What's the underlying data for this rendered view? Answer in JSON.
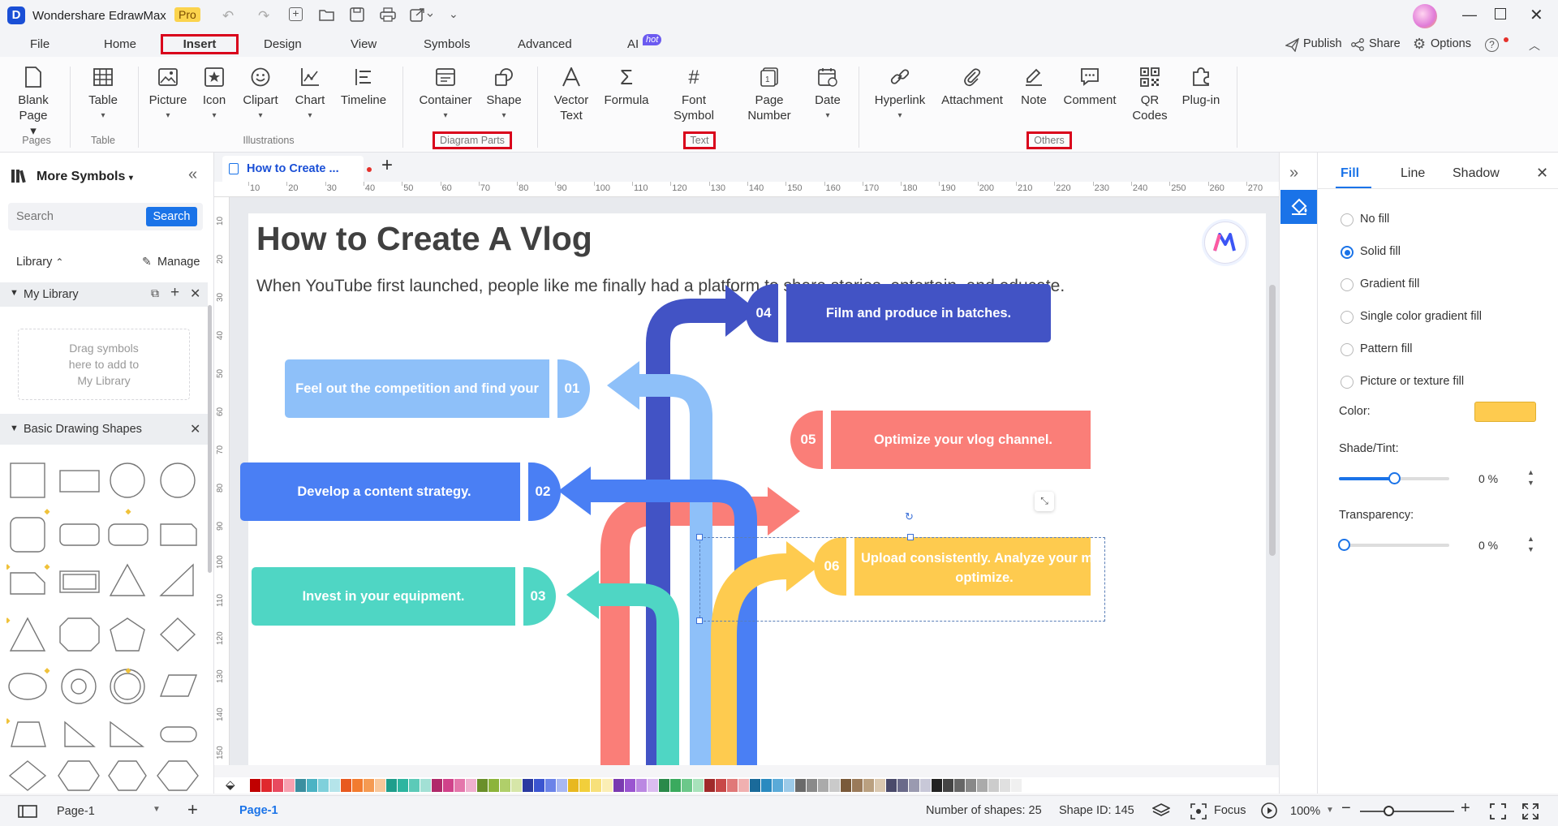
{
  "app": {
    "title": "Wondershare EdrawMax",
    "badge": "Pro"
  },
  "menu": {
    "tabs": [
      "File",
      "Home",
      "Insert",
      "Design",
      "View",
      "Symbols",
      "Advanced",
      "AI"
    ],
    "ai_badge": "hot",
    "active": "Insert",
    "right": {
      "publish": "Publish",
      "share": "Share",
      "options": "Options"
    }
  },
  "ribbon": {
    "pages": {
      "blank_page": "Blank\nPage",
      "group": "Pages"
    },
    "table": {
      "table": "Table",
      "group": "Table"
    },
    "illustrations": {
      "picture": "Picture",
      "icon": "Icon",
      "clipart": "Clipart",
      "chart": "Chart",
      "timeline": "Timeline",
      "group": "Illustrations"
    },
    "diagram_parts": {
      "container": "Container",
      "shape": "Shape",
      "group": "Diagram Parts"
    },
    "text": {
      "vector_text": "Vector\nText",
      "formula": "Formula",
      "font_symbol": "Font\nSymbol",
      "page_number": "Page\nNumber",
      "date": "Date",
      "group": "Text"
    },
    "others": {
      "hyperlink": "Hyperlink",
      "attachment": "Attachment",
      "note": "Note",
      "comment": "Comment",
      "qr_codes": "QR\nCodes",
      "plugin": "Plug-in",
      "group": "Others"
    }
  },
  "left_panel": {
    "title": "More Symbols",
    "search_placeholder": "Search",
    "search_button": "Search",
    "library": "Library",
    "manage": "Manage",
    "my_library": "My Library",
    "drag_hint": "Drag symbols\nhere to add to\nMy Library",
    "basic_shapes": "Basic Drawing Shapes"
  },
  "doc_tab": {
    "name": "How to Create ..."
  },
  "ruler": {
    "top": [
      "10",
      "20",
      "30",
      "40",
      "50",
      "60",
      "70",
      "80",
      "90",
      "100",
      "110",
      "120",
      "130",
      "140",
      "150",
      "160",
      "170",
      "180",
      "190",
      "200",
      "210",
      "220",
      "230",
      "240",
      "250",
      "260",
      "270"
    ],
    "left": [
      "10",
      "20",
      "30",
      "40",
      "50",
      "60",
      "70",
      "80",
      "90",
      "100",
      "110",
      "120",
      "130",
      "140",
      "150"
    ]
  },
  "diagram": {
    "title": "How to Create A Vlog",
    "subtitle": "When YouTube first launched, people like me finally had a platform to share stories, entertain, and educate.",
    "steps": [
      {
        "num": "01",
        "text": "Feel out the competition and find your niche.",
        "color": "#8ec0f9"
      },
      {
        "num": "02",
        "text": "Develop a content strategy.",
        "color": "#4a7ff4"
      },
      {
        "num": "03",
        "text": "Invest in your equipment.",
        "color": "#4fd6c4"
      },
      {
        "num": "04",
        "text": "Film and produce in batches.",
        "color": "#4253c5"
      },
      {
        "num": "05",
        "text": "Optimize your vlog channel.",
        "color": "#fa7e78"
      },
      {
        "num": "06",
        "text": "Upload consistently. Analyze your metrics and optimize.",
        "text_visible_line1": "Upload consistently. Analyze your metri",
        "text_visible_line2": "optimize.",
        "color": "#fecb4f"
      }
    ]
  },
  "right_panel": {
    "tabs": [
      "Fill",
      "Line",
      "Shadow"
    ],
    "active": "Fill",
    "options": [
      "No fill",
      "Solid fill",
      "Gradient fill",
      "Single color gradient fill",
      "Pattern fill",
      "Picture or texture fill"
    ],
    "selected": "Solid fill",
    "color_label": "Color:",
    "color_value": "#fecb4f",
    "shade_label": "Shade/Tint:",
    "shade_value": "0 %",
    "shade_level": 0.5,
    "transparency_label": "Transparency:",
    "transparency_value": "0 %",
    "transparency_level": 0
  },
  "status": {
    "page_selector": "Page-1",
    "active_page": "Page-1",
    "shapes": "Number of shapes: 25",
    "shape_id": "Shape ID: 145",
    "focus": "Focus",
    "zoom": "100%",
    "zoom_level": 0.3
  },
  "palette_colors": [
    "#c00000",
    "#e0282e",
    "#e84a5f",
    "#f7a1b0",
    "#3b8fa0",
    "#4cb3c4",
    "#7fd0db",
    "#b5e4ea",
    "#e85a20",
    "#f27b2f",
    "#f59a52",
    "#f9c79a",
    "#1f9e8c",
    "#2db5a0",
    "#5ccab8",
    "#a2e0d5",
    "#b02a6a",
    "#d0428a",
    "#e476ab",
    "#f0b0cf",
    "#6a8f2a",
    "#8cb43a",
    "#b0cf6a",
    "#d6e6a8",
    "#2a3aa0",
    "#3b55d0",
    "#6b83e8",
    "#a9b8f2",
    "#e8b820",
    "#f2cf3b",
    "#f7e07a",
    "#fbeeb5",
    "#7a3ab0",
    "#9a55d0",
    "#bb88e2",
    "#dbbdf0",
    "#2a8a4a",
    "#3aaa5e",
    "#6cc88a",
    "#a8e2bb",
    "#a02a2a",
    "#c84848",
    "#e07878",
    "#f0b0b0",
    "#1a6a9a",
    "#2a8ac0",
    "#5aaad8",
    "#9ccae8",
    "#6a6a6a",
    "#8a8a8a",
    "#aaaaaa",
    "#cacaca",
    "#7a5a3a",
    "#9a7a5a",
    "#baa080",
    "#dac8b0",
    "#4a4a6a",
    "#6a6a8a",
    "#9a9ab0",
    "#c8c8d8",
    "#222222",
    "#444444",
    "#666666",
    "#888888",
    "#aaaaaa",
    "#cccccc",
    "#e0e0e0",
    "#f0f0f0"
  ]
}
